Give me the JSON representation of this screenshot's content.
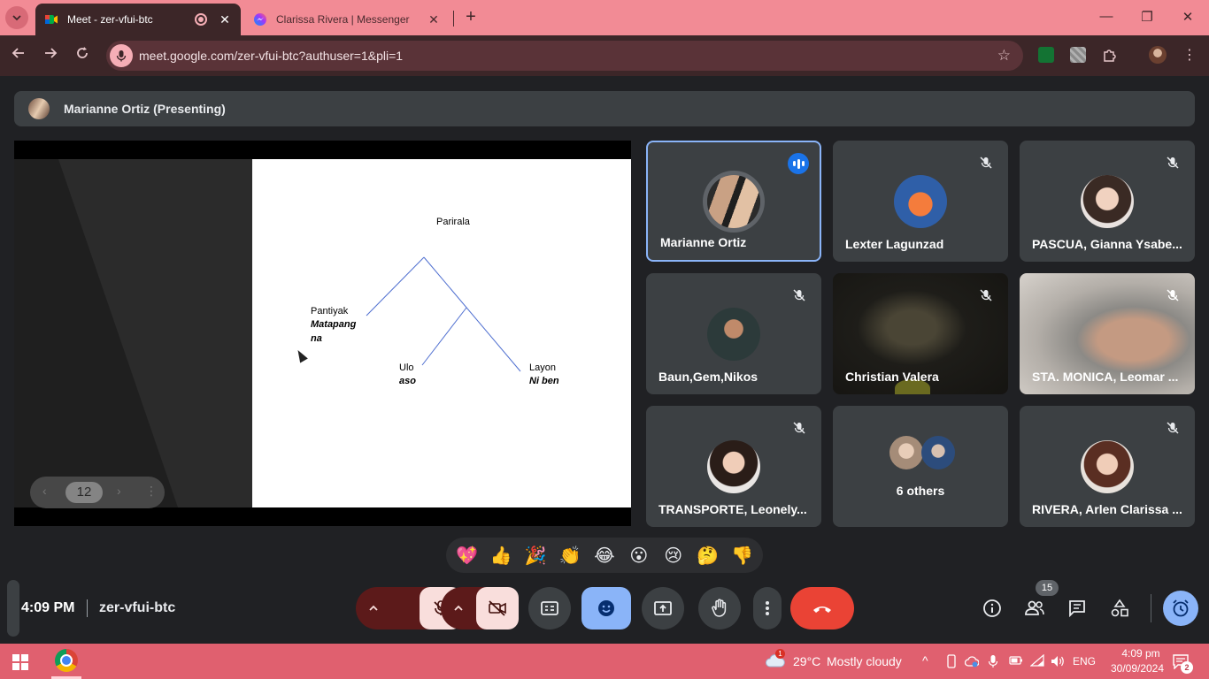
{
  "browser": {
    "tabs": [
      {
        "title": "Meet - zer-vfui-btc",
        "active": true
      },
      {
        "title": "Clarissa Rivera | Messenger",
        "active": false
      }
    ],
    "close_glyph": "✕",
    "new_tab_glyph": "+",
    "url": "meet.google.com/zer-vfui-btc?authuser=1&pli=1",
    "window_controls": {
      "minimize": "—",
      "restore": "❐",
      "close": "✕"
    },
    "colors": {
      "tabstrip": "#f28b95",
      "toolbar": "#3c2628"
    }
  },
  "meet": {
    "presenter": {
      "name": "Marianne Ortiz (Presenting)"
    },
    "slide": {
      "root": "Parirala",
      "left_label": "Pantiyak",
      "left_value_line1": "Matapang",
      "left_value_line2": "na",
      "mid_label": "Ulo",
      "mid_value": "aso",
      "right_label": "Layon",
      "right_value": "Ni ben"
    },
    "pager": {
      "page": "12",
      "prev": "‹",
      "next": "›",
      "more": "⋮"
    },
    "participants": [
      {
        "name": "Marianne Ortiz",
        "speaking": true,
        "muted": false
      },
      {
        "name": "Lexter Lagunzad",
        "muted": true
      },
      {
        "name": "PASCUA, Gianna Ysabe...",
        "muted": true
      },
      {
        "name": "Baun,Gem,Nikos",
        "muted": true
      },
      {
        "name": "Christian Valera",
        "muted": true,
        "video": true
      },
      {
        "name": "STA. MONICA, Leomar ...",
        "muted": true,
        "video": true
      },
      {
        "name": "TRANSPORTE, Leonely...",
        "muted": true
      },
      {
        "name": "6 others"
      },
      {
        "name": "RIVERA, Arlen Clarissa ...",
        "muted": true
      }
    ],
    "reactions": [
      "💖",
      "👍",
      "🎉",
      "👏",
      "😂",
      "😮",
      "😢",
      "🤔",
      "👎"
    ],
    "meeting_time": "4:09 PM",
    "meeting_code": "zer-vfui-btc",
    "people_count": "15",
    "accent_color": "#8ab4f8",
    "end_call_color": "#ea4335"
  },
  "taskbar": {
    "weather_badge": "1",
    "temperature": "29°C",
    "weather": "Mostly cloudy",
    "tray_chevron": "^",
    "language": "ENG",
    "time": "4:09 pm",
    "date": "30/09/2024",
    "notification_count": "2"
  }
}
